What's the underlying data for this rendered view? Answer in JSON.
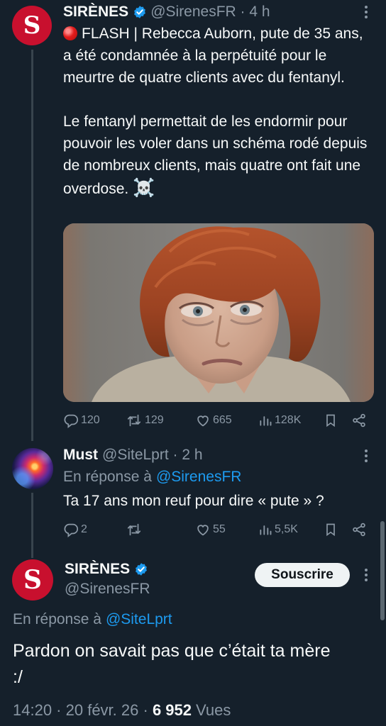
{
  "tweet1": {
    "author_name": "SIRÈNES",
    "handle": "@SirenesFR",
    "time": "4 h",
    "avatar_letter": "S",
    "text_lead": "FLASH | Rebecca Auborn, pute de 35 ans, a été condamnée à la perpétuité pour le meurtre de quatre clients avec du fentanyl.\n\nLe fentanyl permettait de les endormir pour pouvoir les voler dans un schéma rodé depuis de nombreux clients, mais quatre ont fait une overdose. ",
    "emoji": "☠️",
    "stats": {
      "replies": "120",
      "retweets": "129",
      "likes": "665",
      "views": "128K"
    }
  },
  "reply": {
    "author_name": "Must",
    "handle": "@SiteLprt",
    "time": "2 h",
    "in_reply_prefix": "En réponse à",
    "in_reply_handle": "@SirenesFR",
    "text": "Ta 17 ans mon reuf pour dire « pute » ?",
    "stats": {
      "replies": "2",
      "retweets": "",
      "likes": "55",
      "views": "5,5K"
    }
  },
  "main_tweet": {
    "author_name": "SIRÈNES",
    "handle": "@SirenesFR",
    "avatar_letter": "S",
    "subscribe_label": "Souscrire",
    "in_reply_prefix": "En réponse à",
    "in_reply_handle": "@SiteLprt",
    "text": "Pardon on savait pas que c’était ta mère :/",
    "time": "14:20",
    "date": "20 févr. 26",
    "views_count": "6 952",
    "views_label": "Vues"
  },
  "colors": {
    "background": "#15202b",
    "text": "#f7f9f9",
    "muted": "#8b98a5",
    "link": "#1d9bf0",
    "verified": "#1d9bf0",
    "avatar_red": "#c8102e"
  },
  "icons": [
    "reply-icon",
    "retweet-icon",
    "like-icon",
    "views-icon",
    "bookmark-icon",
    "share-icon",
    "verified-badge-icon",
    "more-icon"
  ]
}
